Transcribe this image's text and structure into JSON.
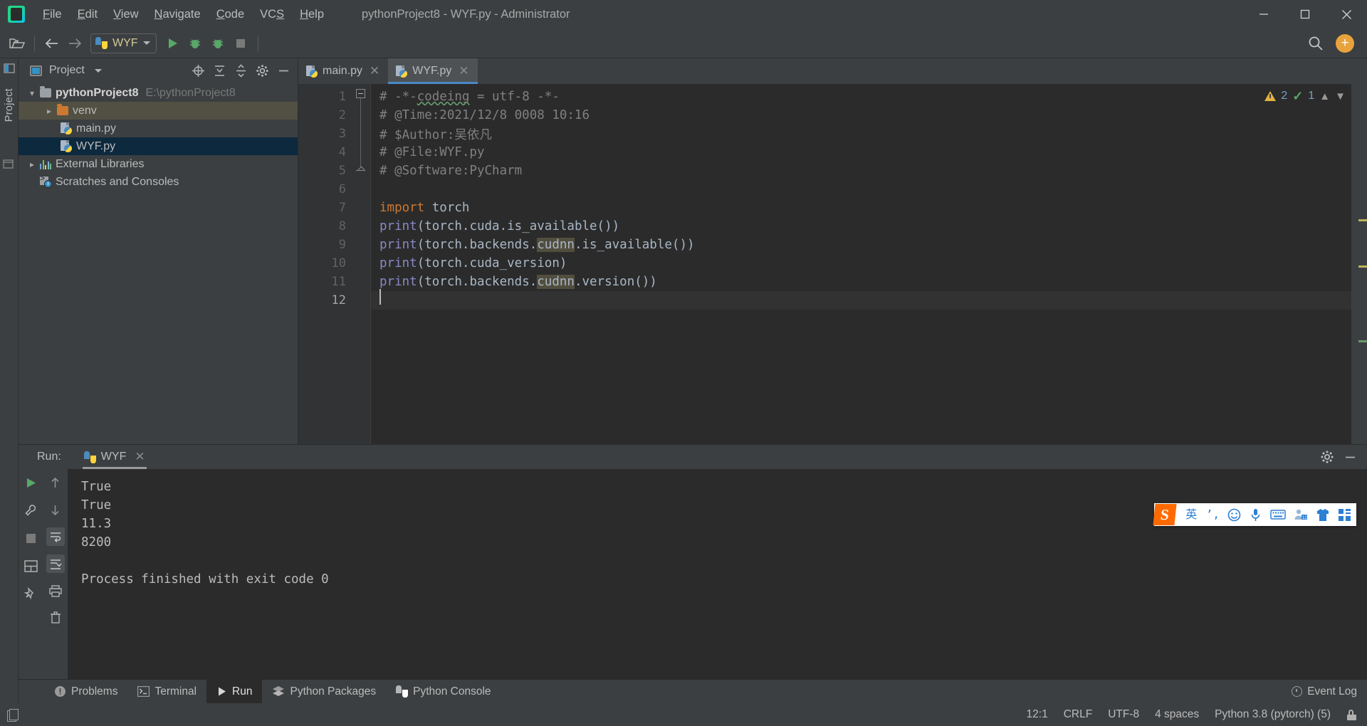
{
  "window": {
    "title": "pythonProject8 - WYF.py - Administrator",
    "menu": [
      {
        "label": "File",
        "mnemonic": "F"
      },
      {
        "label": "Edit",
        "mnemonic": "E"
      },
      {
        "label": "View",
        "mnemonic": "V"
      },
      {
        "label": "Navigate",
        "mnemonic": "N"
      },
      {
        "label": "Code",
        "mnemonic": "C"
      },
      {
        "label": "VCS",
        "mnemonic": "S"
      },
      {
        "label": "Help",
        "mnemonic": "H"
      }
    ],
    "controls": {
      "minimize": "minimize-icon",
      "maximize": "maximize-icon",
      "close": "close-icon"
    }
  },
  "toolbar": {
    "open_label": "open-folder-icon",
    "back_label": "back-arrow-icon",
    "forward_label": "forward-arrow-icon",
    "run_config": "WYF",
    "run_label": "run-icon",
    "debug_label": "debug-icon",
    "coverage_label": "coverage-icon",
    "stop_label": "stop-icon",
    "search_label": "search-icon",
    "account_label": "+"
  },
  "left_strip": {
    "project_label": "Project"
  },
  "project_panel": {
    "title": "Project",
    "icons": [
      "locate-icon",
      "expand-all-icon",
      "collapse-all-icon",
      "settings-icon",
      "hide-icon"
    ],
    "tree": [
      {
        "label": "pythonProject8",
        "path": "E:\\pythonProject8",
        "arrow": "expanded",
        "icon": "folder-icon",
        "indent": 0,
        "state": "normal",
        "bold": true
      },
      {
        "label": "venv",
        "path": "",
        "arrow": "collapsed",
        "icon": "folder-orange-icon",
        "indent": 1,
        "state": "hovered",
        "bold": false
      },
      {
        "label": "main.py",
        "path": "",
        "arrow": "none",
        "icon": "python-file-icon",
        "indent": 2,
        "state": "normal",
        "bold": false
      },
      {
        "label": "WYF.py",
        "path": "",
        "arrow": "none",
        "icon": "python-file-icon",
        "indent": 2,
        "state": "selected",
        "bold": false
      },
      {
        "label": "External Libraries",
        "path": "",
        "arrow": "collapsed",
        "icon": "library-icon",
        "indent": 0,
        "state": "normal",
        "bold": false
      },
      {
        "label": "Scratches and Consoles",
        "path": "",
        "arrow": "none",
        "icon": "scratches-icon",
        "indent": 0,
        "state": "normal",
        "bold": false
      }
    ]
  },
  "editor": {
    "tabs": [
      {
        "label": "main.py",
        "active": false
      },
      {
        "label": "WYF.py",
        "active": true
      }
    ],
    "line_numbers": [
      "1",
      "2",
      "3",
      "4",
      "5",
      "6",
      "7",
      "8",
      "9",
      "10",
      "11",
      "12"
    ],
    "lines": [
      {
        "n": 1,
        "segments": [
          {
            "t": "# -*-",
            "c": "cm"
          },
          {
            "t": "codeing",
            "c": "cm squiggle"
          },
          {
            "t": " = utf-8 -*-",
            "c": "cm"
          }
        ]
      },
      {
        "n": 2,
        "segments": [
          {
            "t": "# @Time:2021/12/8 0008 10:16",
            "c": "cm"
          }
        ]
      },
      {
        "n": 3,
        "segments": [
          {
            "t": "# $Author:吴依凡",
            "c": "cm"
          }
        ]
      },
      {
        "n": 4,
        "segments": [
          {
            "t": "# @File:WYF.py",
            "c": "cm"
          }
        ]
      },
      {
        "n": 5,
        "segments": [
          {
            "t": "# @Software:PyCharm",
            "c": "cm"
          }
        ]
      },
      {
        "n": 6,
        "segments": []
      },
      {
        "n": 7,
        "segments": [
          {
            "t": "import",
            "c": "kw"
          },
          {
            "t": " torch",
            "c": "plain"
          }
        ]
      },
      {
        "n": 8,
        "segments": [
          {
            "t": "print",
            "c": "fn"
          },
          {
            "t": "(torch.cuda.is_available())",
            "c": "plain"
          }
        ]
      },
      {
        "n": 9,
        "segments": [
          {
            "t": "print",
            "c": "fn"
          },
          {
            "t": "(torch.backends.",
            "c": "plain"
          },
          {
            "t": "cudnn",
            "c": "plain hl"
          },
          {
            "t": ".is_available())",
            "c": "plain"
          }
        ]
      },
      {
        "n": 10,
        "segments": [
          {
            "t": "print",
            "c": "fn"
          },
          {
            "t": "(torch.cuda_version)",
            "c": "plain"
          }
        ]
      },
      {
        "n": 11,
        "segments": [
          {
            "t": "print",
            "c": "fn"
          },
          {
            "t": "(torch.backends.",
            "c": "plain"
          },
          {
            "t": "cudnn",
            "c": "plain hl"
          },
          {
            "t": ".version())",
            "c": "plain"
          }
        ]
      },
      {
        "n": 12,
        "segments": []
      }
    ],
    "inspections": {
      "warning_count": "2",
      "ok_count": "1",
      "up_label": "chevron-up-icon",
      "down_label": "chevron-down-icon"
    }
  },
  "run_panel": {
    "run_label": "Run:",
    "tab_label": "WYF",
    "console_lines": [
      "True",
      "True",
      "11.3",
      "8200",
      "",
      "Process finished with exit code 0"
    ],
    "left_tools": [
      "rerun-icon",
      "wrench-icon",
      "stop-icon",
      "layout-icon",
      "pin-icon"
    ],
    "second_tools": [
      "up-arrow-icon",
      "down-arrow-icon",
      "soft-wrap-icon",
      "scroll-to-end-icon",
      "print-icon",
      "trash-icon"
    ],
    "header_icons": [
      "settings-icon",
      "hide-icon"
    ]
  },
  "ime": {
    "logo": "S",
    "items": [
      "英",
      "’,",
      "smiley-icon",
      "mic-icon",
      "keyboard-icon",
      "user-icon",
      "skin-icon",
      "apps-icon"
    ]
  },
  "toolwindow_bar": {
    "items": [
      {
        "label": "Problems",
        "icon": "problems-icon",
        "active": false
      },
      {
        "label": "Terminal",
        "icon": "terminal-icon",
        "active": false
      },
      {
        "label": "Run",
        "icon": "run-icon",
        "active": true
      },
      {
        "label": "Python Packages",
        "icon": "packages-icon",
        "active": false
      },
      {
        "label": "Python Console",
        "icon": "python-icon",
        "active": false
      }
    ],
    "event_log": "Event Log"
  },
  "statusbar": {
    "caret": "12:1",
    "line_sep": "CRLF",
    "encoding": "UTF-8",
    "indent": "4 spaces",
    "interpreter": "Python 3.8 (pytorch) (5)",
    "lock": "lock-icon",
    "left_icon": "editor-layout-icon"
  }
}
